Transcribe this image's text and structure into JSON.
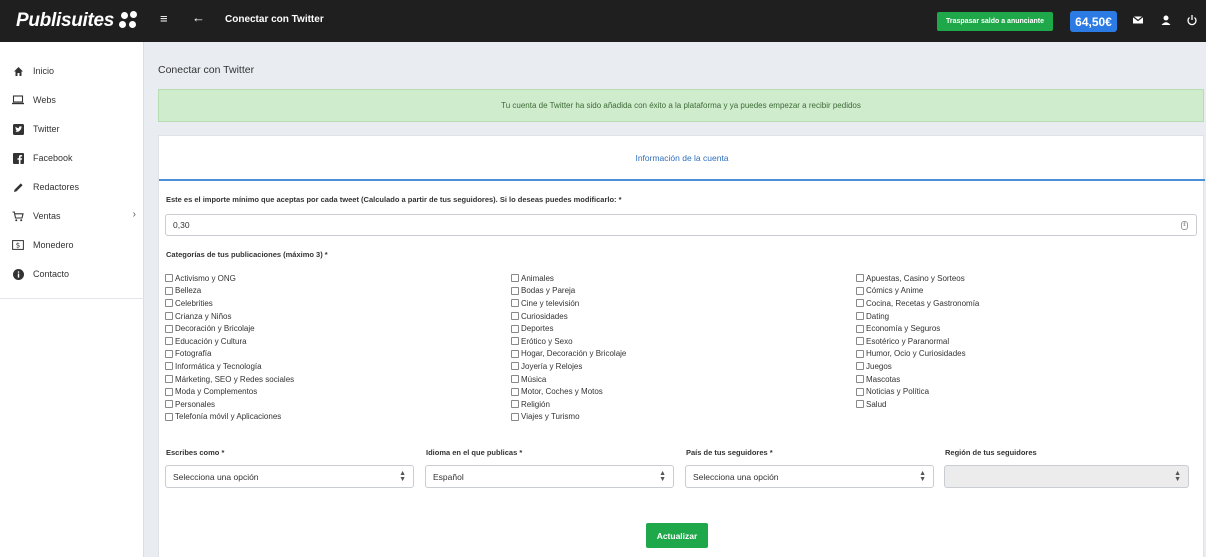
{
  "topbar": {
    "logo": "Publisuites",
    "title": "Conectar con Twitter",
    "traspasar_label": "Traspasar saldo a anunciante",
    "balance": "64,50€"
  },
  "sidebar": {
    "items": [
      {
        "label": "Inicio",
        "icon": "home-icon"
      },
      {
        "label": "Webs",
        "icon": "laptop-icon"
      },
      {
        "label": "Twitter",
        "icon": "twitter-icon"
      },
      {
        "label": "Facebook",
        "icon": "facebook-icon"
      },
      {
        "label": "Redactores",
        "icon": "pencil-icon"
      },
      {
        "label": "Ventas",
        "icon": "cart-icon"
      },
      {
        "label": "Monedero",
        "icon": "wallet-icon"
      },
      {
        "label": "Contacto",
        "icon": "info-icon"
      }
    ]
  },
  "main": {
    "page_title": "Conectar con Twitter",
    "alert": "Tu cuenta de Twitter ha sido añadida con éxito a la plataforma y ya puedes empezar a recibir pedidos",
    "card_tab": "Información de la cuenta",
    "amount_label": "Este es el importe mínimo que aceptas por cada tweet (Calculado a partir de tus seguidores). Si lo deseas puedes modificarlo: *",
    "amount_value": "0,30",
    "categories_label": "Categorías de tus publicaciones (máximo 3) *",
    "categories_col1": [
      "Activismo y ONG",
      "Belleza",
      "Celebrities",
      "Crianza y Niños",
      "Decoración y Bricolaje",
      "Educación y Cultura",
      "Fotografía",
      "Informática y Tecnología",
      "Márketing, SEO y Redes sociales",
      "Moda y Complementos",
      "Personales",
      "Telefonía móvil y Aplicaciones"
    ],
    "categories_col2": [
      "Animales",
      "Bodas y Pareja",
      "Cine y televisión",
      "Curiosidades",
      "Deportes",
      "Erótico y Sexo",
      "Hogar, Decoración y Bricolaje",
      "Joyería y Relojes",
      "Música",
      "Motor, Coches y Motos",
      "Religión",
      "Viajes y Turismo"
    ],
    "categories_col3": [
      "Apuestas, Casino y Sorteos",
      "Cómics y Anime",
      "Cocina, Recetas y Gastronomía",
      "Dating",
      "Economía y Seguros",
      "Esotérico y Paranormal",
      "Humor, Ocio y Curiosidades",
      "Juegos",
      "Mascotas",
      "Noticias y Política",
      "Salud"
    ],
    "writes_as_label": "Escribes como *",
    "writes_as_value": "Selecciona una opción",
    "language_label": "Idioma en el que publicas *",
    "language_value": "Español",
    "country_label": "País de tus seguidores *",
    "country_value": "Selecciona una opción",
    "region_label": "Región de tus seguidores",
    "region_value": "",
    "update_label": "Actualizar"
  },
  "colors": {
    "topbar": "#1f1f1f",
    "success_green": "#1fa84a",
    "balance_blue": "#2c7be5",
    "alert_bg": "#cfeccc",
    "tab_blue": "#2f6fbd"
  }
}
